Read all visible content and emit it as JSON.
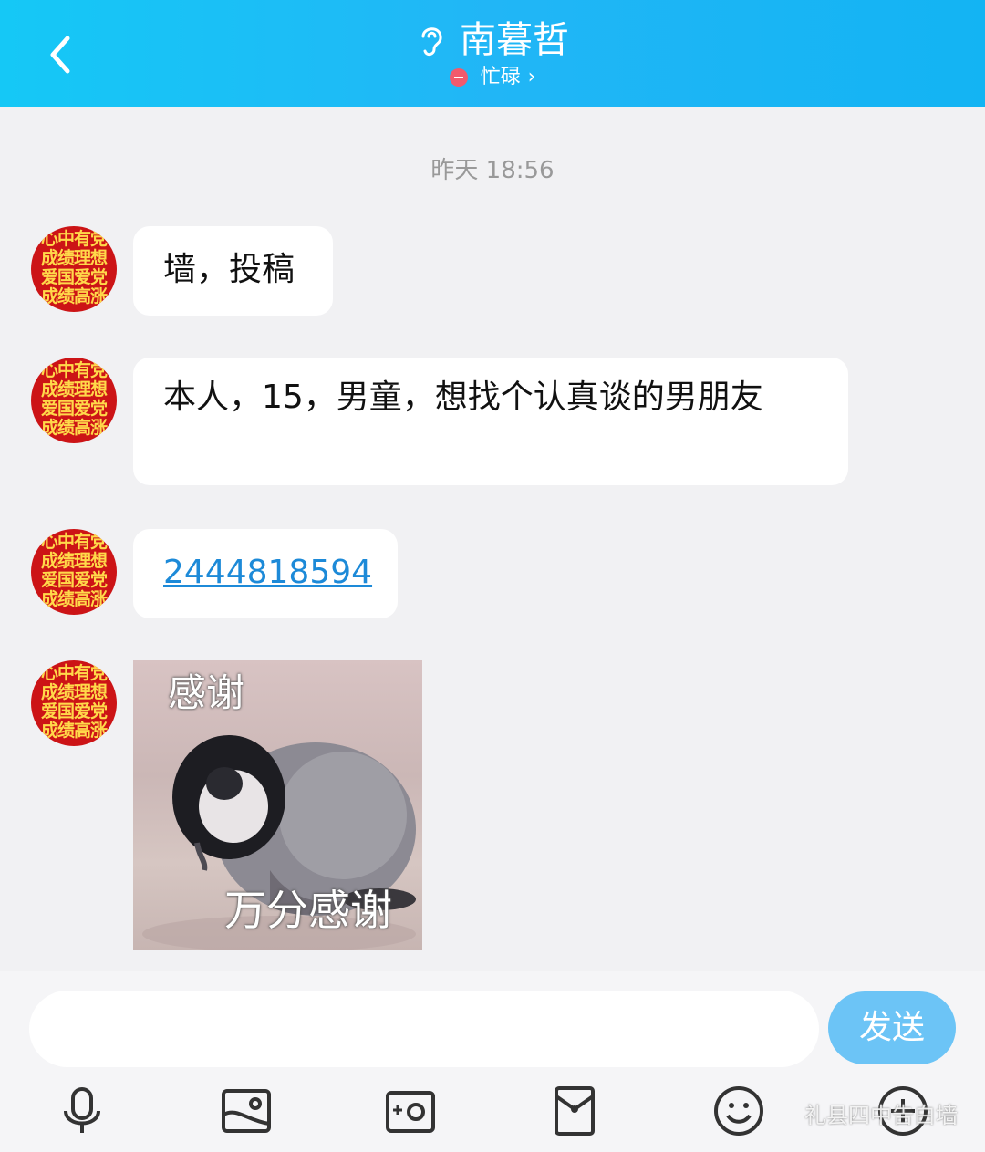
{
  "header": {
    "title": "南暮哲",
    "status": "忙碌",
    "status_chevron": "›",
    "colors": {
      "gradient_start": "#15c8f6",
      "gradient_end": "#13b4f3",
      "busy_dot": "#f25a6c"
    }
  },
  "chat": {
    "timestamp": "昨天 18:56",
    "avatar_text": [
      "心中有党",
      "成绩理想",
      "爱国爱党",
      "成绩高涨"
    ],
    "messages": [
      {
        "type": "text",
        "text": "墙，投稿"
      },
      {
        "type": "text",
        "text": "本人，15，男童，想找个认真谈的男朋友"
      },
      {
        "type": "link",
        "text": "2444818594"
      },
      {
        "type": "sticker",
        "top_caption": "感谢",
        "bottom_caption": "万分感谢"
      }
    ]
  },
  "input": {
    "placeholder": "",
    "value": "",
    "send_label": "发送"
  },
  "toolbar": {
    "icons": [
      "microphone-icon",
      "image-icon",
      "camera-icon",
      "red-packet-icon",
      "emoji-icon",
      "plus-icon"
    ]
  },
  "watermark": "礼县四中告白墙"
}
